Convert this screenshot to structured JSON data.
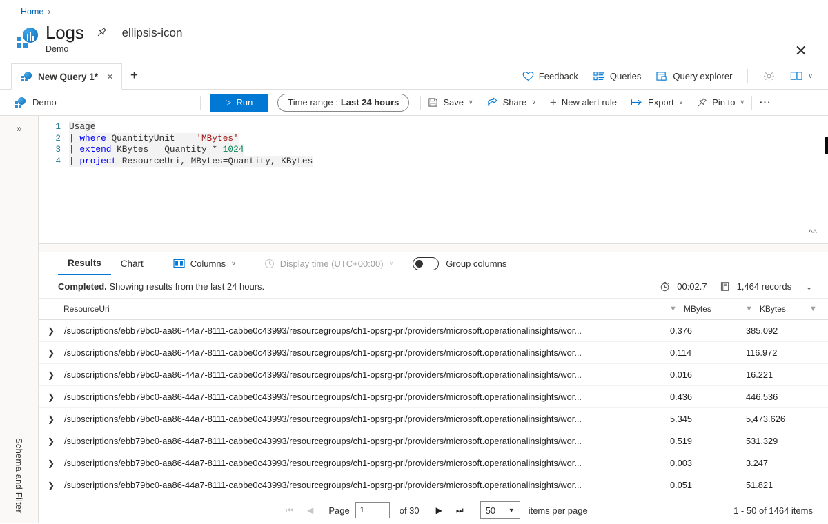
{
  "breadcrumb": {
    "home": "Home",
    "separator": "›"
  },
  "header": {
    "title": "Logs",
    "subtitle": "Demo",
    "pin_icon": "pin-icon",
    "more_icon": "ellipsis-icon",
    "close_icon": "close-icon"
  },
  "tabs": {
    "query_tab": "New Query 1*",
    "close_label": "×",
    "add_label": "+",
    "right_items": [
      {
        "label": "Feedback",
        "icon": "heart-icon"
      },
      {
        "label": "Queries",
        "icon": "list-icon"
      },
      {
        "label": "Query explorer",
        "icon": "window-icon"
      }
    ],
    "settings_icon": "gear-icon",
    "book_icon": "book-icon",
    "book_chevron": "∨"
  },
  "commandbar": {
    "scope": "Demo",
    "run": "Run",
    "run_icon": "play-icon",
    "time_range_label": "Time range :",
    "time_range_value": "Last 24 hours",
    "items": [
      {
        "label": "Save",
        "icon": "save-icon",
        "chevron": "∨",
        "disabled": false
      },
      {
        "label": "Share",
        "icon": "share-icon",
        "chevron": "∨",
        "disabled": false
      },
      {
        "label": "New alert rule",
        "icon": "plus-icon",
        "chevron": "",
        "disabled": false
      },
      {
        "label": "Export",
        "icon": "export-icon",
        "chevron": "∨",
        "disabled": false
      },
      {
        "label": "Pin to",
        "icon": "pin-icon",
        "chevron": "∨",
        "disabled": false
      }
    ],
    "more_icon": "ellipsis-icon"
  },
  "sidebar": {
    "expand_icon": "double-chevron-right-icon",
    "label": "Schema and Filter"
  },
  "editor": {
    "lines": [
      {
        "n": "1",
        "tokens": [
          {
            "t": "Usage",
            "c": ""
          }
        ]
      },
      {
        "n": "2",
        "tokens": [
          {
            "t": "| ",
            "c": "pipe"
          },
          {
            "t": "where",
            "c": "kw"
          },
          {
            "t": " QuantityUnit == ",
            "c": ""
          },
          {
            "t": "'MBytes'",
            "c": "str"
          }
        ]
      },
      {
        "n": "3",
        "tokens": [
          {
            "t": "| ",
            "c": "pipe"
          },
          {
            "t": "extend",
            "c": "kw"
          },
          {
            "t": " KBytes = Quantity * ",
            "c": ""
          },
          {
            "t": "1024",
            "c": "num"
          }
        ]
      },
      {
        "n": "4",
        "tokens": [
          {
            "t": "| ",
            "c": "pipe"
          },
          {
            "t": "project",
            "c": "kw"
          },
          {
            "t": " ResourceUri, MBytes=Quantity, KBytes",
            "c": ""
          }
        ]
      }
    ],
    "collapse_icon": "double-chevron-up-icon",
    "splitter_icon": "drag-handle-icon"
  },
  "results": {
    "tabs": [
      {
        "label": "Results",
        "active": true
      },
      {
        "label": "Chart",
        "active": false
      }
    ],
    "columns_button": "Columns",
    "columns_icon": "columns-icon",
    "columns_chevron": "∨",
    "display_time": "Display time (UTC+00:00)",
    "display_time_icon": "clock-icon",
    "display_time_chevron": "∨",
    "group_columns": "Group columns",
    "status_bold": "Completed.",
    "status_rest": " Showing results from the last 24 hours.",
    "timer_icon": "stopwatch-icon",
    "timer": "00:02.7",
    "records_icon": "records-icon",
    "records": "1,464 records",
    "expand_status_icon": "double-chevron-down-icon"
  },
  "table": {
    "expander_icon": "chevron-right-icon",
    "filter_icon": "funnel-icon",
    "columns": [
      "ResourceUri",
      "MBytes",
      "KBytes"
    ],
    "rows": [
      {
        "uri": "/subscriptions/ebb79bc0-aa86-44a7-8111-cabbe0c43993/resourcegroups/ch1-opsrg-pri/providers/microsoft.operationalinsights/wor...",
        "mbytes": "0.376",
        "kbytes": "385.092"
      },
      {
        "uri": "/subscriptions/ebb79bc0-aa86-44a7-8111-cabbe0c43993/resourcegroups/ch1-opsrg-pri/providers/microsoft.operationalinsights/wor...",
        "mbytes": "0.114",
        "kbytes": "116.972"
      },
      {
        "uri": "/subscriptions/ebb79bc0-aa86-44a7-8111-cabbe0c43993/resourcegroups/ch1-opsrg-pri/providers/microsoft.operationalinsights/wor...",
        "mbytes": "0.016",
        "kbytes": "16.221"
      },
      {
        "uri": "/subscriptions/ebb79bc0-aa86-44a7-8111-cabbe0c43993/resourcegroups/ch1-opsrg-pri/providers/microsoft.operationalinsights/wor...",
        "mbytes": "0.436",
        "kbytes": "446.536"
      },
      {
        "uri": "/subscriptions/ebb79bc0-aa86-44a7-8111-cabbe0c43993/resourcegroups/ch1-opsrg-pri/providers/microsoft.operationalinsights/wor...",
        "mbytes": "5.345",
        "kbytes": "5,473.626"
      },
      {
        "uri": "/subscriptions/ebb79bc0-aa86-44a7-8111-cabbe0c43993/resourcegroups/ch1-opsrg-pri/providers/microsoft.operationalinsights/wor...",
        "mbytes": "0.519",
        "kbytes": "531.329"
      },
      {
        "uri": "/subscriptions/ebb79bc0-aa86-44a7-8111-cabbe0c43993/resourcegroups/ch1-opsrg-pri/providers/microsoft.operationalinsights/wor...",
        "mbytes": "0.003",
        "kbytes": "3.247"
      },
      {
        "uri": "/subscriptions/ebb79bc0-aa86-44a7-8111-cabbe0c43993/resourcegroups/ch1-opsrg-pri/providers/microsoft.operationalinsights/wor...",
        "mbytes": "0.051",
        "kbytes": "51.821"
      }
    ]
  },
  "pager": {
    "first_icon": "⏮",
    "prev_icon": "◀",
    "next_icon": "▶",
    "last_icon": "⏭",
    "page_label": "Page",
    "page_value": "1",
    "of_label": "of 30",
    "page_size": "50",
    "page_size_chevron": "▼",
    "items_per_page": "items per page",
    "total": "1 - 50 of 1464 items"
  },
  "colors": {
    "accent": "#0078d4",
    "link": "#0063b1",
    "border": "#e1dfdd"
  }
}
